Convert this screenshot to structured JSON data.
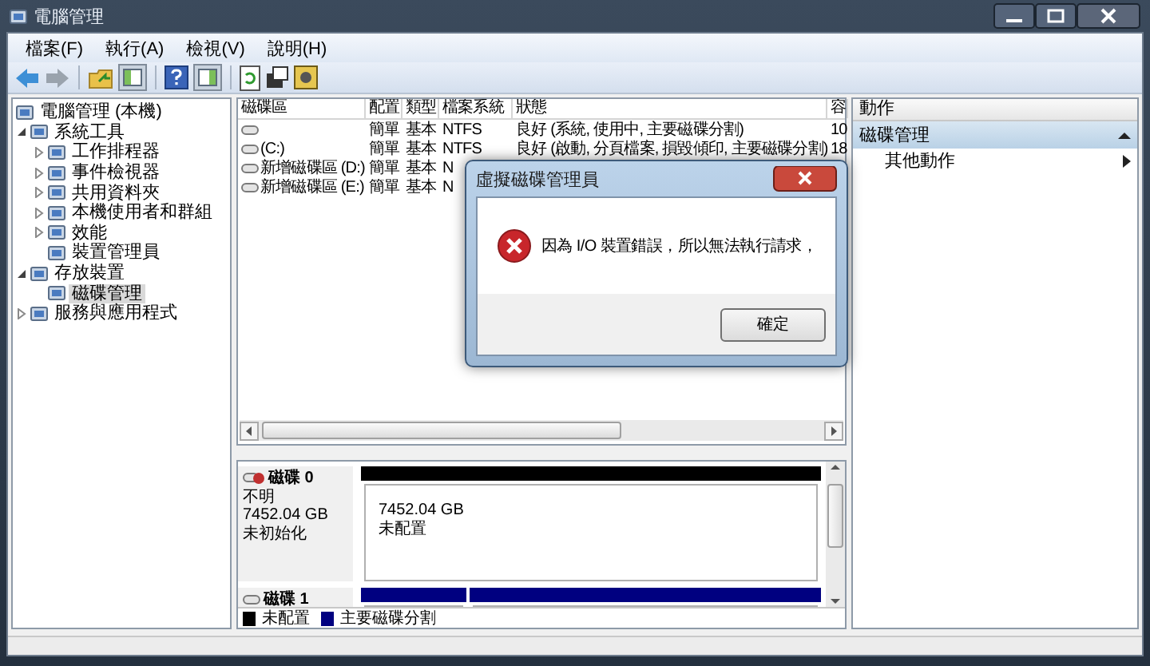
{
  "window": {
    "title": "電腦管理"
  },
  "menu": [
    "檔案(F)",
    "執行(A)",
    "檢視(V)",
    "說明(H)"
  ],
  "tree": [
    {
      "label": "電腦管理 (本機)",
      "kind": "root",
      "selected": false,
      "children": [
        {
          "label": "系統工具",
          "kind": "branch",
          "expanded": true,
          "selected": false,
          "children": [
            {
              "label": "工作排程器",
              "kind": "branch",
              "expanded": false,
              "selected": false
            },
            {
              "label": "事件檢視器",
              "kind": "branch",
              "expanded": false,
              "selected": false
            },
            {
              "label": "共用資料夾",
              "kind": "branch",
              "expanded": false,
              "selected": false
            },
            {
              "label": "本機使用者和群組",
              "kind": "branch",
              "expanded": false,
              "selected": false
            },
            {
              "label": "效能",
              "kind": "branch",
              "expanded": false,
              "selected": false
            },
            {
              "label": "裝置管理員",
              "kind": "leaf",
              "selected": false
            }
          ]
        },
        {
          "label": "存放裝置",
          "kind": "branch",
          "expanded": true,
          "selected": false,
          "children": [
            {
              "label": "磁碟管理",
              "kind": "leaf",
              "selected": true
            }
          ]
        },
        {
          "label": "服務與應用程式",
          "kind": "branch",
          "expanded": false,
          "selected": false
        }
      ]
    }
  ],
  "volumes": {
    "columns": [
      "磁碟區",
      "配置",
      "類型",
      "檔案系統",
      "狀態",
      "容"
    ],
    "rows": [
      {
        "layout": "簡單",
        "type": "基本",
        "file_system": "NTFS",
        "status": "良好 (系統, 使用中, 主要磁碟分割)",
        "capacity": "10"
      },
      {
        "volume": "(C:)",
        "layout": "簡單",
        "type": "基本",
        "file_system": "NTFS",
        "status": "良好 (啟動, 分頁檔案, 損毀傾印, 主要磁碟分割)",
        "capacity": "18"
      },
      {
        "volume": "新增磁碟區 (D:)",
        "layout": "簡單",
        "type": "基本",
        "file_system": "N"
      },
      {
        "volume": "新增磁碟區 (E:)",
        "layout": "簡單",
        "type": "基本",
        "file_system": "N"
      }
    ]
  },
  "disks": [
    {
      "name": "磁碟 0",
      "kind": "unknown",
      "info": [
        "不明",
        "7452.04 GB",
        "未初始化"
      ],
      "partitions": [
        {
          "size": "7452.04 GB",
          "status": "未配置",
          "color": "#000000"
        }
      ]
    },
    {
      "name": "磁碟 1",
      "kind": "basic",
      "partitions": [
        {
          "color": "#000080"
        },
        {
          "color": "#000080"
        }
      ]
    }
  ],
  "legend": [
    {
      "label": "未配置",
      "color": "#000000"
    },
    {
      "label": "主要磁碟分割",
      "color": "#000080"
    }
  ],
  "actions": {
    "title": "動作",
    "sections": [
      {
        "label": "磁碟管理",
        "expanded": true,
        "items": [
          "其他動作"
        ]
      }
    ]
  },
  "dialog": {
    "title": "虛擬磁碟管理員",
    "message": "因為 I/O 裝置錯誤，所以無法執行請求，",
    "buttons": [
      "確定"
    ]
  }
}
